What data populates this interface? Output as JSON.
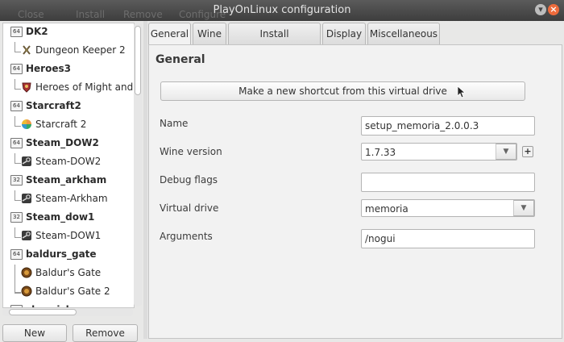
{
  "window": {
    "title": "PlayOnLinux configuration",
    "ghost_menu": [
      "Close",
      "Install",
      "Remove",
      "Configure"
    ]
  },
  "tree": [
    {
      "prefix": "DK2",
      "arch": "64",
      "game": "Dungeon Keeper 2",
      "icon": "dungeon-keeper-icon"
    },
    {
      "prefix": "Heroes3",
      "arch": "64",
      "game": "Heroes of Might and M",
      "icon": "heroes-icon"
    },
    {
      "prefix": "Starcraft2",
      "arch": "64",
      "game": "Starcraft 2",
      "icon": "starcraft-icon"
    },
    {
      "prefix": "Steam_DOW2",
      "arch": "64",
      "game": "Steam-DOW2",
      "icon": "steam-icon"
    },
    {
      "prefix": "Steam_arkham",
      "arch": "32",
      "game": "Steam-Arkham",
      "icon": "steam-icon"
    },
    {
      "prefix": "Steam_dow1",
      "arch": "32",
      "game": "Steam-DOW1",
      "icon": "steam-icon"
    },
    {
      "prefix": "baldurs_gate",
      "arch": "64",
      "games": [
        "Baldur's Gate",
        "Baldur's Gate 2"
      ],
      "icon": "baldurs-gate-icon"
    },
    {
      "prefix": "chronicles",
      "arch": "64"
    }
  ],
  "left_buttons": {
    "new": "New",
    "remove": "Remove"
  },
  "tabs": [
    "General",
    "Wine",
    "Install components",
    "Display",
    "Miscellaneous"
  ],
  "general": {
    "title": "General",
    "shortcut_button": "Make a new shortcut from this virtual drive",
    "name_label": "Name",
    "name_value": "setup_memoria_2.0.0.3",
    "wine_label": "Wine version",
    "wine_value": "1.7.33",
    "debug_label": "Debug flags",
    "debug_value": "",
    "drive_label": "Virtual drive",
    "drive_value": "memoria",
    "args_label": "Arguments",
    "args_value": "/nogui"
  }
}
